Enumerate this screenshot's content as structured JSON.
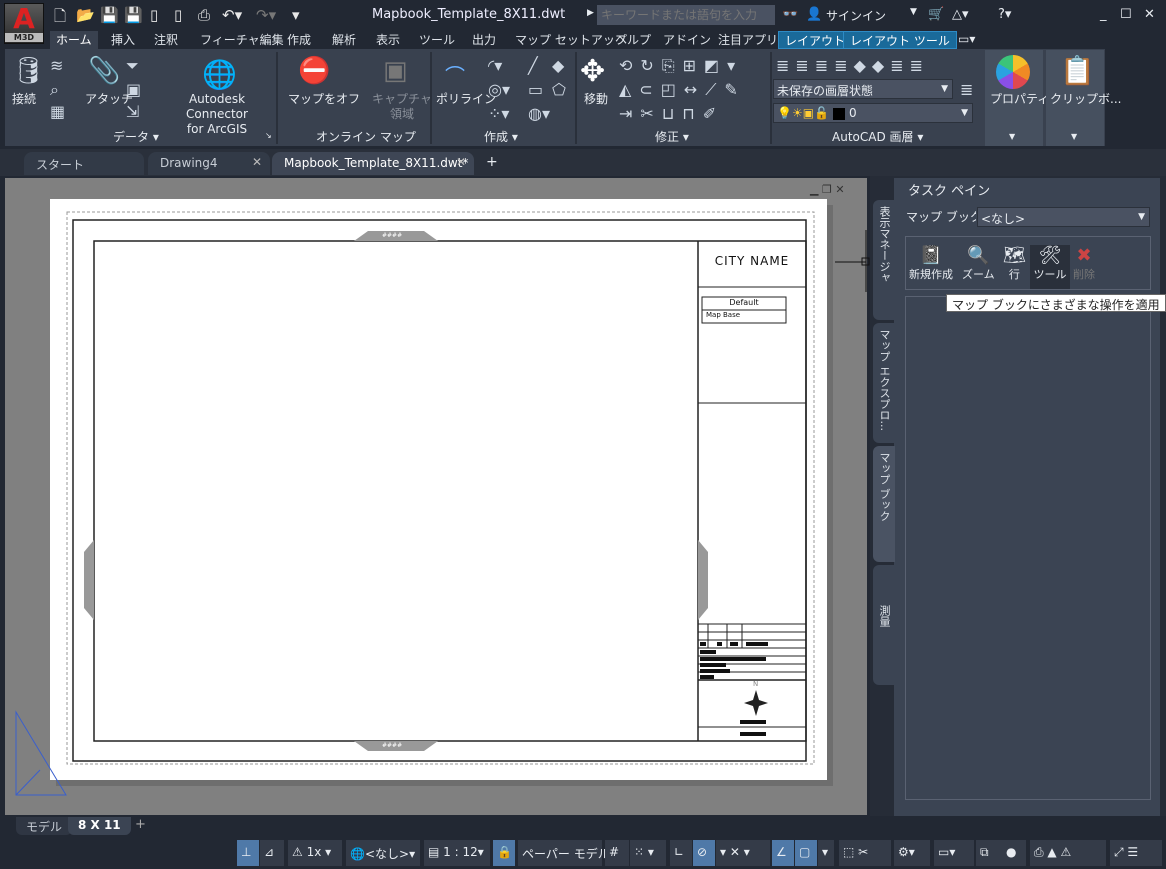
{
  "app": {
    "logo": "A",
    "logo_sub": "M3D",
    "title": "Mapbook_Template_8X11.dwt",
    "search_placeholder": "キーワードまたは語句を入力",
    "signin": "サインイン"
  },
  "ribbon_tabs": [
    "ホーム",
    "挿入",
    "注釈",
    "フィーチャ編集",
    "作成",
    "解析",
    "表示",
    "ツール",
    "出力",
    "マップ セットアップ",
    "ヘルプ",
    "アドイン",
    "注目アプリ",
    "レイアウト",
    "レイアウト ツール"
  ],
  "ribbon": {
    "data_panel": {
      "label": "データ ▾",
      "connect": "接続",
      "attach": "アタッチ",
      "connector": "Autodesk Connector",
      "connector2": "for ArcGIS"
    },
    "online_panel": {
      "label": "オンライン マップ",
      "map_off": "マップをオフ",
      "capture1": "キャプチャ",
      "capture2": "領域"
    },
    "create_panel": {
      "label": "作成 ▾",
      "polyline": "ポリライン"
    },
    "modify_panel": {
      "label": "修正 ▾",
      "move": "移動"
    },
    "layer_panel": {
      "label": "AutoCAD 画層 ▾",
      "layer_state": "未保存の画層状態",
      "layer": "0"
    },
    "properties": "プロパティ",
    "clipboard": "クリップボ..."
  },
  "doc_tabs": [
    {
      "label": "スタート"
    },
    {
      "label": "Drawing4"
    },
    {
      "label": "Mapbook_Template_8X11.dwt*"
    }
  ],
  "drawing": {
    "city_name": "CITY NAME",
    "legend_header": "Default",
    "legend_row": "Map Base",
    "marker": "####",
    "north": "N"
  },
  "task_pane": {
    "title": "タスク ペイン",
    "vertical_tabs": [
      "表示マネージャ",
      "マップ エクスプロ...",
      "マップ ブック",
      "測量"
    ],
    "mapbook_label": "マップ ブック",
    "mapbook_value": "<なし>",
    "tools": [
      "新規作成",
      "ズーム",
      "行",
      "ツール",
      "削除"
    ],
    "tooltip": "マップ ブックにさまざまな操作を適用"
  },
  "layout_tabs": [
    "モデル",
    "8 X 11"
  ],
  "status": {
    "scale_annot": "1x",
    "coord": "<なし>",
    "scale": "1 : 12",
    "paper": "ペーパー",
    "model": "モデル"
  },
  "colors": {
    "accent": "#4f79a8",
    "ribbon": "#39414f",
    "canvas": "#808080"
  }
}
